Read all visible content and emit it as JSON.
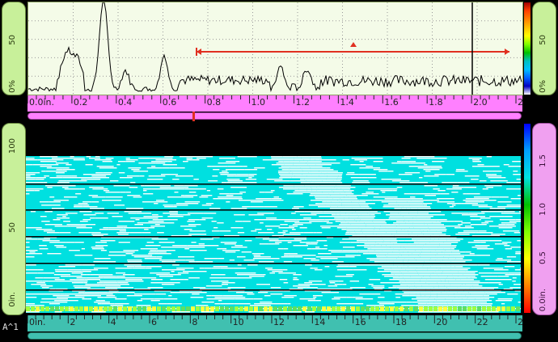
{
  "a_scan": {
    "amp_labels": [
      "50",
      "0%"
    ],
    "amp_labels_right": [
      "50",
      "0%"
    ],
    "x_axis_labels": [
      "0.0in.",
      "0.2",
      "0.4",
      "0.6",
      "0.8",
      "1.0",
      "1.2",
      "1.4",
      "1.6",
      "1.8",
      "2.0",
      "2"
    ],
    "gate_color": "#e03020",
    "cursor_color": "#000000",
    "waveform_color": "#000000"
  },
  "c_scan": {
    "y_labels": [
      "100",
      "50",
      "0in."
    ],
    "right_labels": [
      "1.5",
      "1.0",
      "0.5",
      "0.0in."
    ],
    "x_axis_labels": [
      "0in.",
      "2",
      "4",
      "6",
      "8",
      "10",
      "12",
      "14",
      "16",
      "18",
      "20",
      "22",
      "2"
    ],
    "fill_color": "#00e0e0",
    "gap_color": "#ffffff"
  },
  "status": {
    "mode_label": "A^1"
  },
  "palette": {
    "colors": [
      "#c00000",
      "#ff8000",
      "#ffff00",
      "#00c000",
      "#00c0c0",
      "#0000ff",
      "#000080"
    ]
  }
}
